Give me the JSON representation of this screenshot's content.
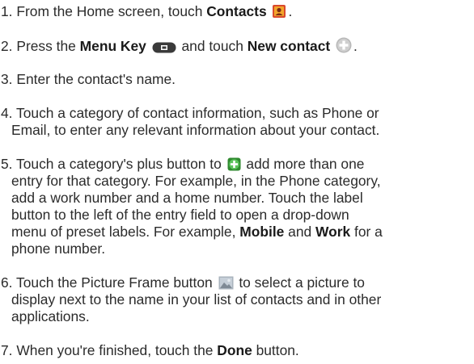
{
  "steps": [
    {
      "num": "1.",
      "pre": "From the Home screen, touch ",
      "b1": "Contacts",
      "post": ".",
      "icon": "contacts-app-icon"
    },
    {
      "num": "2.",
      "pre": "Press the ",
      "b1": "Menu Key",
      "mid": " and touch ",
      "b2": "New contact",
      "post": ".",
      "icon1": "menu-key-icon",
      "icon2": "new-contact-plus-icon"
    },
    {
      "num": "3.",
      "text": "Enter the contact's name."
    },
    {
      "num": "4.",
      "lines": [
        "Touch a category of contact information, such as Phone or",
        "Email, to enter any relevant information about your contact."
      ]
    },
    {
      "num": "5.",
      "line1_pre": "Touch a category's plus button to ",
      "line1_post": " add more than one",
      "icon": "add-entry-plus-icon",
      "lines": [
        "entry for that category. For example, in the Phone category,",
        "add a work number and a home number. Touch the label",
        "button to the left of the entry field to open a drop-down"
      ],
      "last_pre": "menu of preset labels. For example, ",
      "b1": "Mobile",
      "last_mid": " and ",
      "b2": "Work",
      "last_post": " for a",
      "last_line": "phone number."
    },
    {
      "num": "6.",
      "line1_pre": "Touch the Picture Frame button ",
      "line1_post": " to select a picture to",
      "icon": "picture-frame-icon",
      "lines": [
        "display next to the name in your list of contacts and in other",
        "applications."
      ]
    },
    {
      "num": "7.",
      "pre": "When you're finished, touch the ",
      "b1": "Done",
      "post": " button."
    }
  ],
  "colors": {
    "text": "#2b2b2b",
    "contacts_icon": "#d9492e",
    "plus_green": "#3aa13a",
    "plus_gray": "#b8b8b8"
  }
}
